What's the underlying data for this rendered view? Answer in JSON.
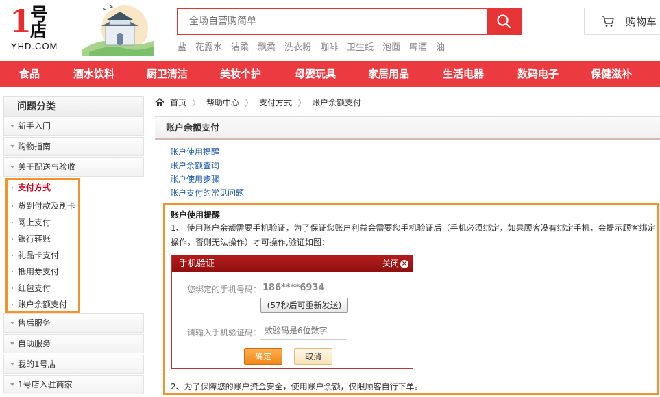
{
  "header": {
    "logo_number": "1",
    "logo_hao": "号",
    "logo_dian": "店",
    "logo_text": "YHD.COM",
    "search_placeholder": "全场自营购简单",
    "hotwords": [
      "盐",
      "花露水",
      "洁柔",
      "飘柔",
      "洗衣粉",
      "咖啡",
      "卫生纸",
      "泡面",
      "啤酒",
      "油"
    ],
    "cart_label": "购物车"
  },
  "nav": {
    "items": [
      "食品",
      "酒水饮料",
      "厨卫清洁",
      "美妆个护",
      "母婴玩具",
      "家居用品",
      "生活电器",
      "数码电子",
      "保健滋补"
    ]
  },
  "sidebar": {
    "title": "问题分类",
    "categories": [
      "新手入门",
      "购物指南",
      "关于配送与验收",
      "售后服务",
      "自助服务",
      "我的1号店",
      "1号店入驻商家"
    ],
    "sub_items": [
      "支付方式",
      "货到付款及刷卡",
      "网上支付",
      "银行转账",
      "礼品卡支付",
      "抵用券支付",
      "红包支付",
      "账户余额支付"
    ]
  },
  "breadcrumb": [
    "首页",
    "帮助中心",
    "支付方式",
    "账户余额支付"
  ],
  "main": {
    "title": "账户余额支付",
    "links": [
      "账户使用提醒",
      "账户余额查询",
      "账户使用步骤",
      "账户支付的常见问题"
    ],
    "section_heading": "账户使用提醒",
    "para1": "1、 使用账户余额需要手机验证，为了保证您账户利益会需要您手机验证后（手机必须绑定，如果顾客没有绑定手机，会提示顾客绑定操作，否则无法操作）才可操作,验证如图：",
    "para2": "2、为了保障您的账户资金安全，使用账户余额，仅限顾客自行下单。"
  },
  "dialog": {
    "title": "手机验证",
    "close_label": "关闭",
    "phone_label": "您绑定的手机号码：",
    "phone_value": "186****6934",
    "resend_label": "(57秒后可重新发送)",
    "code_label": "请输入手机验证码：",
    "code_placeholder": "效验码是6位数字",
    "ok_label": "确定",
    "cancel_label": "取消"
  },
  "colors": {
    "brand_red": "#ec3b40",
    "highlight_orange": "#f5922b",
    "link_blue": "#1c5aa6"
  }
}
